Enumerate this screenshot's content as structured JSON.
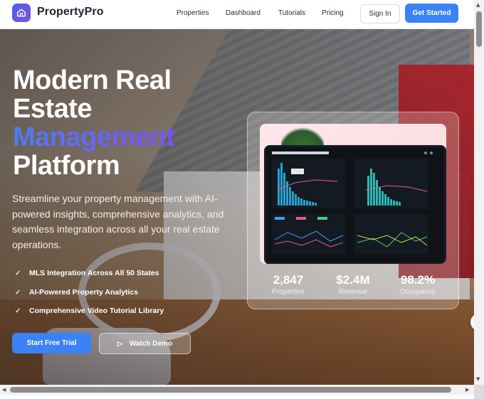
{
  "nav": {
    "brand": "PropertyPro",
    "links": [
      "Properties",
      "Dashboard",
      "Tutorials",
      "Pricing"
    ],
    "sign_in": "Sign In",
    "get_started": "Get Started"
  },
  "hero": {
    "title_line1": "Modern Real",
    "title_line2": "Estate",
    "title_accent": "Management",
    "title_line4": "Platform",
    "subtitle": "Streamline your property management with AI-powered insights, comprehensive analytics, and seamless integration across all your real estate operations.",
    "features": [
      "MLS Integration Across All 50 States",
      "AI-Powered Property Analytics",
      "Comprehensive Video Tutorial Library"
    ],
    "cta_primary": "Start Free Trial",
    "cta_secondary": "Watch Demo"
  },
  "stats": [
    {
      "value": "2,847",
      "label": "Properties"
    },
    {
      "value": "$2.4M",
      "label": "Revenue"
    },
    {
      "value": "98.2%",
      "label": "Occupancy"
    }
  ],
  "icons": {
    "logo": "home-icon",
    "check": "check-icon",
    "play": "play-icon",
    "side_widget": "brain-icon"
  },
  "colors": {
    "accent": "#3b82f6",
    "gradient_start": "#4f7df5",
    "gradient_end": "#8a3ff0"
  }
}
